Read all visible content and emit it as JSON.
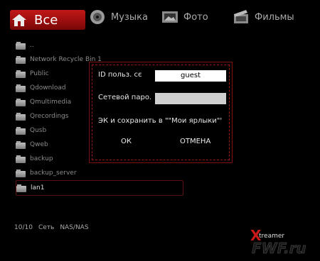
{
  "tabs": [
    {
      "label": "Все",
      "icon": "home-icon"
    },
    {
      "label": "Музыка",
      "icon": "music-disc-icon"
    },
    {
      "label": "Фото",
      "icon": "photo-icon"
    },
    {
      "label": "Фильмы",
      "icon": "film-icon"
    }
  ],
  "folders": [
    {
      "label": "..",
      "icon": "up-folder-icon"
    },
    {
      "label": "Network Recycle Bin 1",
      "icon": "folder-icon"
    },
    {
      "label": "Public",
      "icon": "folder-icon"
    },
    {
      "label": "Qdownload",
      "icon": "folder-icon"
    },
    {
      "label": "Qmultimedia",
      "icon": "folder-icon"
    },
    {
      "label": "Qrecordings",
      "icon": "folder-icon"
    },
    {
      "label": "Qusb",
      "icon": "folder-icon"
    },
    {
      "label": "Qweb",
      "icon": "folder-icon"
    },
    {
      "label": "backup",
      "icon": "folder-icon"
    },
    {
      "label": "backup_server",
      "icon": "folder-icon"
    },
    {
      "label": "lan1",
      "icon": "folder-icon",
      "selected": true
    }
  ],
  "status": {
    "counter": "10/10",
    "section": "Сеть",
    "path": "NAS/NAS"
  },
  "dialog": {
    "user_label": "ID польз. сє",
    "user_value": "guest",
    "password_label": "Сетевой паро.",
    "save_label": "ЭК и сохранить в \"\"Мои ярлыки\"'",
    "ok_label": "ОК",
    "cancel_label": "ОТМЕНА"
  },
  "branding": {
    "logo_text": "treamer",
    "watermark": "FWF.ru"
  },
  "colors": {
    "accent": "#c21818",
    "background": "#000000"
  }
}
